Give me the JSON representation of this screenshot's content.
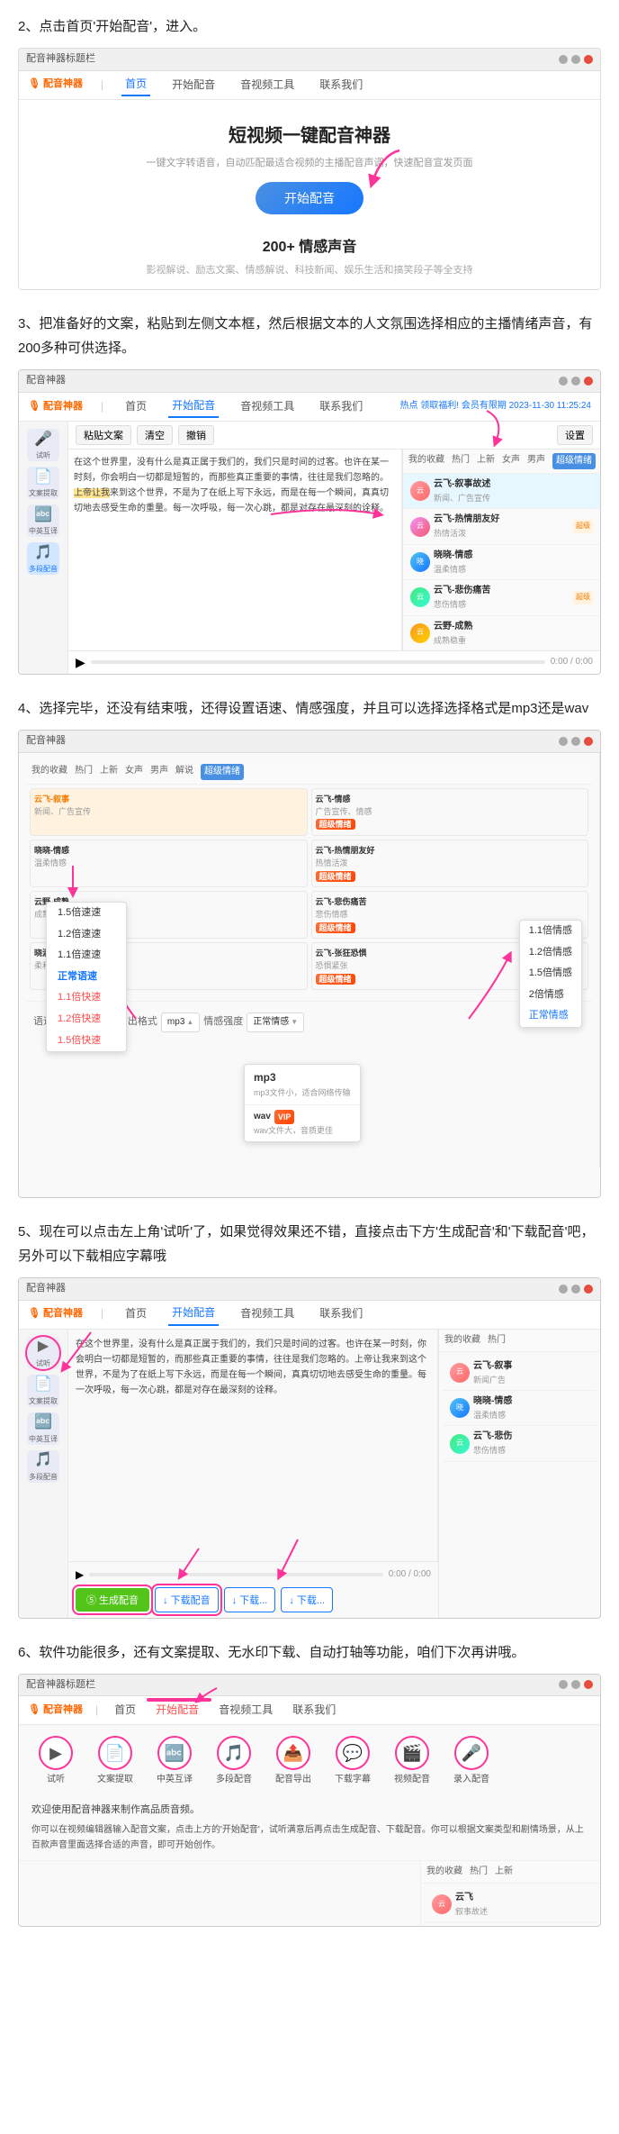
{
  "page": {
    "step2": {
      "label": "2、点击首页'开始配音'，进入。",
      "app_title": "配音神器标题栏",
      "nav": {
        "logo": "配音神器",
        "items": [
          "首页",
          "开始配音",
          "音视频工具",
          "联系我们"
        ]
      },
      "hero": {
        "title": "短视频一键配音神器",
        "subtitle": "一键文字转语音，自动匹配最适合视频的主播配音声调，快速配音宣发页面",
        "button": "开始配音",
        "badge": "200+ 情感声音",
        "badge_sub": "影视解说、励志文案、情感解说、科技新闻、娱乐生活和搞笑段子等全支持"
      }
    },
    "step3": {
      "label": "3、把准备好的文案，粘贴到左侧文本框，然后根据文本的人文氛围选择相应的主播情绪声音，有200多种可供选择。",
      "nav_items": [
        "配音神器",
        "首页",
        "开始配音",
        "音视频工具",
        "联系我们"
      ],
      "sample_text": "在这个世界里，没有什么是真正属于我们的，我们只是时间的过客。也许在某一时刻，你会明白一切都是短暂的，而那些真正重要的事情，往往是我们忽略的。上帝让我来到这个世界，不是为了在纸上写下永远，而是在每一个瞬间，真真切切地去感受生命的重量。每一次呼吸，每一次心跳，都是对存在最深刻的诠释。",
      "voice_tabs": [
        "我的收藏",
        "热门",
        "上新",
        "女声",
        "男声",
        "解说",
        "超级情绪"
      ],
      "voice_list": [
        {
          "name": "云飞-叙事",
          "desc": "新闻、广告宣传",
          "tag": ""
        },
        {
          "name": "云飞-情感",
          "desc": "广告宣传、情感",
          "tag": "超级情绪"
        },
        {
          "name": "晓晓-情感",
          "desc": "温柔、情感",
          "tag": ""
        },
        {
          "name": "云野-成熟",
          "desc": "成熟稳重",
          "tag": ""
        },
        {
          "name": "晓涵-情感",
          "desc": "柔和温暖",
          "tag": ""
        },
        {
          "name": "云飞-热情朋友好",
          "desc": "热情活泼",
          "tag": "超级情绪"
        },
        {
          "name": "云飞-悲伤痛苦",
          "desc": "悲伤情感",
          "tag": "超级情绪"
        },
        {
          "name": "云飞-张狂恐惧",
          "desc": "恐惧紧张",
          "tag": "超级情绪"
        }
      ]
    },
    "step4": {
      "label": "4、选择完毕，还没有结束哦，还得设置语速、情感强度，并且可以选择选择格式是mp3还是wav",
      "speed_options": [
        "1.5倍速速",
        "1.2倍速速",
        "1.1倍速速",
        "正常语速",
        "1.1倍快速",
        "1.2倍快速",
        "1.5倍快速"
      ],
      "speed_selected": "正常语速",
      "format_options": [
        {
          "value": "mp3",
          "label": "mp3",
          "desc": "mp3文件小，适合网络传输"
        },
        {
          "value": "wav",
          "label": "wav",
          "desc": "wav文件大，音质更佳"
        }
      ],
      "emotion_options": [
        "1.1倍情感",
        "1.2倍情感",
        "1.5倍情感",
        "2倍情感",
        "正常情感"
      ],
      "emotion_selected": "正常情感",
      "settings": {
        "speed_label": "语速",
        "speed_value": "正常语速",
        "format_label": "输出格式",
        "format_value": "mp3",
        "emotion_label": "情感强度",
        "emotion_value": "正常情感"
      }
    },
    "step5": {
      "label": "5、现在可以点击左上角'试听'了，如果觉得效果还不错，直接点击下方'生成配音'和'下载配音'吧，另外可以下载相应字幕哦",
      "buttons": {
        "generate": "⑤ 生成配音",
        "download_audio": "↓ 下载配音",
        "download_sub1": "↓ 下载...",
        "download_sub2": "↓ 下载..."
      }
    },
    "step6": {
      "label": "6、软件功能很多，还有文案提取、无水印下载、自动打轴等功能，咱们下次再讲哦。",
      "nav_items": [
        "配音神器",
        "首页",
        "开始配音",
        "音视频工具",
        "联系我们"
      ],
      "icons": [
        {
          "name": "试听",
          "icon": "▶"
        },
        {
          "name": "文案提取",
          "icon": "📄"
        },
        {
          "name": "中英互译",
          "icon": "🔤"
        },
        {
          "name": "多段配音",
          "icon": "🎵"
        },
        {
          "name": "配音导出",
          "icon": "📤"
        },
        {
          "name": "下载字幕",
          "icon": "💬"
        },
        {
          "name": "视频配音",
          "icon": "🎬"
        },
        {
          "name": "录入配音",
          "icon": "🎤"
        }
      ],
      "welcome_text": "欢迎使用配音神器来制作高品质音频。",
      "instructions": "你可以在视频编辑器输入配音文案，点击上方的'开始配音'，试听满意后再点击生成配音、下载配音。你可以根据文案类型和剧情场景，从上百款声音里面选择合适的声音，即可开始创作。",
      "voice_tabs": [
        "我的收藏",
        "热门",
        "上新"
      ]
    }
  }
}
